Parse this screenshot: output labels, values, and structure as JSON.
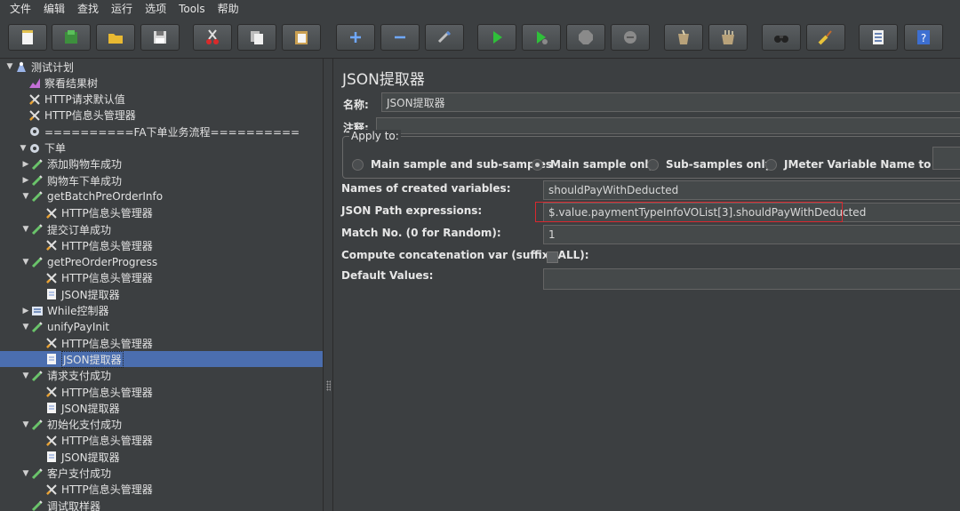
{
  "menu": [
    "文件",
    "编辑",
    "查找",
    "运行",
    "选项",
    "Tools",
    "帮助"
  ],
  "toolbar_icons": [
    "new-icon",
    "templates-icon",
    "open-icon",
    "save-icon",
    "cut-icon",
    "copy-icon",
    "paste-icon",
    "expand-icon",
    "collapse-icon",
    "toggle-icon",
    "start-icon",
    "start-no-pause-icon",
    "stop-icon",
    "shutdown-icon",
    "clear-icon",
    "clear-all-icon",
    "search-icon",
    "reset-search-icon",
    "function-helper-icon",
    "help-icon"
  ],
  "tree": [
    {
      "label": "测试计划",
      "icon": "test-plan-icon",
      "indent": 0,
      "arrow": "▼"
    },
    {
      "label": "察看结果树",
      "icon": "results-tree-icon",
      "indent": 1,
      "arrow": ""
    },
    {
      "label": "HTTP请求默认值",
      "icon": "config-element-icon",
      "indent": 1,
      "arrow": ""
    },
    {
      "label": "HTTP信息头管理器",
      "icon": "config-element-icon",
      "indent": 1,
      "arrow": ""
    },
    {
      "label": "==========FA下单业务流程==========",
      "icon": "thread-group-icon",
      "indent": 1,
      "arrow": ""
    },
    {
      "label": "下单",
      "icon": "thread-group-icon",
      "indent": 1,
      "arrow": "▼"
    },
    {
      "label": "添加购物车成功",
      "icon": "sampler-icon",
      "indent": 2,
      "arrow": "▶"
    },
    {
      "label": "购物车下单成功",
      "icon": "sampler-icon",
      "indent": 2,
      "arrow": "▶"
    },
    {
      "label": "getBatchPreOrderInfo",
      "icon": "sampler-icon",
      "indent": 2,
      "arrow": "▼"
    },
    {
      "label": "HTTP信息头管理器",
      "icon": "config-element-icon",
      "indent": 3,
      "arrow": ""
    },
    {
      "label": "提交订单成功",
      "icon": "sampler-icon",
      "indent": 2,
      "arrow": "▼"
    },
    {
      "label": "HTTP信息头管理器",
      "icon": "config-element-icon",
      "indent": 3,
      "arrow": ""
    },
    {
      "label": "getPreOrderProgress",
      "icon": "sampler-icon",
      "indent": 2,
      "arrow": "▼"
    },
    {
      "label": "HTTP信息头管理器",
      "icon": "config-element-icon",
      "indent": 3,
      "arrow": ""
    },
    {
      "label": "JSON提取器",
      "icon": "json-extractor-icon",
      "indent": 3,
      "arrow": ""
    },
    {
      "label": "While控制器",
      "icon": "while-controller-icon",
      "indent": 2,
      "arrow": "▶"
    },
    {
      "label": "unifyPayInit",
      "icon": "sampler-icon",
      "indent": 2,
      "arrow": "▼"
    },
    {
      "label": "HTTP信息头管理器",
      "icon": "config-element-icon",
      "indent": 3,
      "arrow": ""
    },
    {
      "label": "JSON提取器",
      "icon": "json-extractor-icon",
      "indent": 3,
      "arrow": "",
      "selected": true
    },
    {
      "label": "请求支付成功",
      "icon": "sampler-icon",
      "indent": 2,
      "arrow": "▼"
    },
    {
      "label": "HTTP信息头管理器",
      "icon": "config-element-icon",
      "indent": 3,
      "arrow": ""
    },
    {
      "label": "JSON提取器",
      "icon": "json-extractor-icon",
      "indent": 3,
      "arrow": ""
    },
    {
      "label": "初始化支付成功",
      "icon": "sampler-icon",
      "indent": 2,
      "arrow": "▼"
    },
    {
      "label": "HTTP信息头管理器",
      "icon": "config-element-icon",
      "indent": 3,
      "arrow": ""
    },
    {
      "label": "JSON提取器",
      "icon": "json-extractor-icon",
      "indent": 3,
      "arrow": ""
    },
    {
      "label": "客户支付成功",
      "icon": "sampler-icon",
      "indent": 2,
      "arrow": "▼"
    },
    {
      "label": "HTTP信息头管理器",
      "icon": "config-element-icon",
      "indent": 3,
      "arrow": ""
    },
    {
      "label": "调试取样器",
      "icon": "sampler-icon",
      "indent": 2,
      "arrow": ""
    }
  ],
  "panel": {
    "title": "JSON提取器",
    "name_label": "名称:",
    "name_value": "JSON提取器",
    "comment_label": "注释:",
    "comment_value": "",
    "apply_to_label": "Apply to:",
    "radios": [
      {
        "label": "Main sample and sub-samples",
        "checked": false
      },
      {
        "label": "Main sample only",
        "checked": true
      },
      {
        "label": "Sub-samples only",
        "checked": false
      },
      {
        "label": "JMeter Variable Name to use",
        "checked": false
      }
    ],
    "jmeter_var_value": "",
    "created_vars_label": "Names of created variables:",
    "created_vars_value": "shouldPayWithDeducted",
    "json_path_label": "JSON Path expressions:",
    "json_path_value": "$.value.paymentTypeInfoVOList[3].shouldPayWithDeducted",
    "match_no_label": "Match No. (0 for Random):",
    "match_no_value": "1",
    "concat_label": "Compute concatenation var (suffix _ALL):",
    "concat_checked": false,
    "default_label": "Default Values:",
    "default_value": ""
  },
  "colors": {
    "selection": "#4b6eaf",
    "highlight_box": "#d9282f"
  }
}
